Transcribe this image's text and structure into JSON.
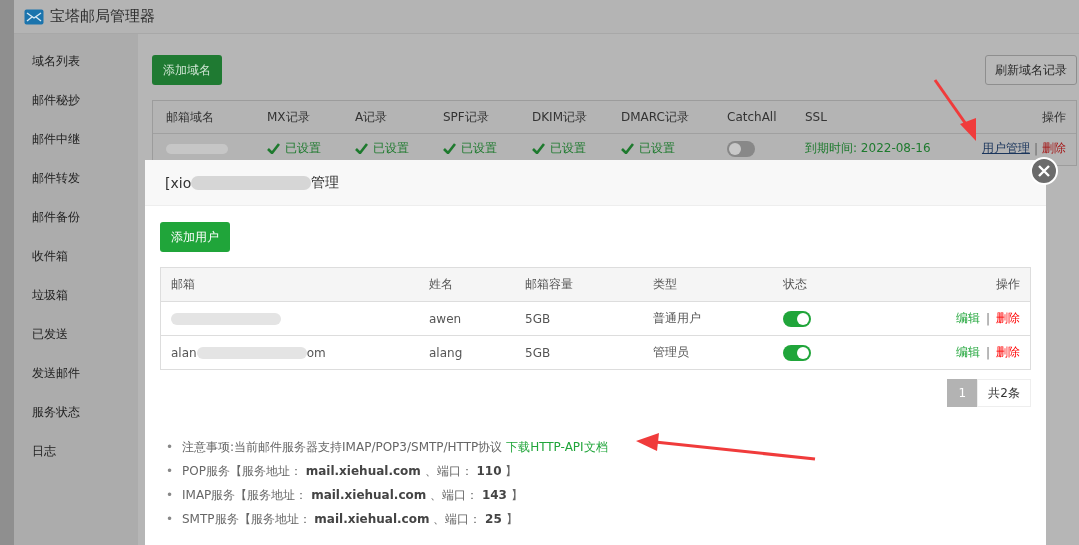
{
  "window": {
    "title": "宝塔邮局管理器"
  },
  "sidebar": {
    "items": [
      {
        "label": "域名列表"
      },
      {
        "label": "邮件秘抄"
      },
      {
        "label": "邮件中继"
      },
      {
        "label": "邮件转发"
      },
      {
        "label": "邮件备份"
      },
      {
        "label": "收件箱"
      },
      {
        "label": "垃圾箱"
      },
      {
        "label": "已发送"
      },
      {
        "label": "发送邮件"
      },
      {
        "label": "服务状态"
      },
      {
        "label": "日志"
      }
    ]
  },
  "toolbar": {
    "add_button": "添加域名",
    "refresh_button": "刷新域名记录"
  },
  "domain_table": {
    "columns": [
      "邮箱域名",
      "MX记录",
      "A记录",
      "SPF记录",
      "DKIM记录",
      "DMARC记录",
      "CatchAll",
      "SSL",
      "操作"
    ],
    "rows": [
      {
        "records": [
          {
            "text": "已设置",
            "ok": true
          },
          {
            "text": "已设置",
            "ok": true
          },
          {
            "text": "已设置",
            "ok": true
          },
          {
            "text": "已设置",
            "ok": true
          },
          {
            "text": "已设置",
            "ok": true
          }
        ],
        "catchall_on": false,
        "ssl": "到期时间: 2022-08-16",
        "actions": [
          "用户管理",
          "删除"
        ],
        "separator": "|"
      }
    ]
  },
  "dialog": {
    "title_prefix": "[xio",
    "title_suffix": "管理",
    "add_button": "添加用户",
    "columns": [
      "邮箱",
      "姓名",
      "邮箱容量",
      "类型",
      "状态",
      "操作"
    ],
    "rows": [
      {
        "email_prefix": "",
        "email_suffix": "",
        "name": "awen",
        "quota": "5GB",
        "type": "普通用户",
        "on": true,
        "actions": [
          "编辑",
          "删除"
        ],
        "separator": "|"
      },
      {
        "email_prefix": "alan",
        "email_suffix": "om",
        "name": "alang",
        "quota": "5GB",
        "type": "管理员",
        "on": true,
        "actions": [
          "编辑",
          "删除"
        ],
        "separator": "|"
      }
    ],
    "pagination": {
      "pages": [
        {
          "label": "1",
          "selected": true
        }
      ],
      "total": "共2条"
    },
    "note_bullet": "•",
    "notes": [
      {
        "text": "注意事项:当前邮件服务器支持IMAP/POP3/SMTP/HTTP协议",
        "link": "下载HTTP-API文档"
      },
      {
        "text": "POP服务【服务地址： **mail.xiehual.com** 、端口： **110** 】"
      },
      {
        "text": "IMAP服务【服务地址： **mail.xiehual.com** 、端口： **143** 】"
      },
      {
        "text": "SMTP服务【服务地址： **mail.xiehual.com** 、端口： **25** 】"
      }
    ]
  }
}
